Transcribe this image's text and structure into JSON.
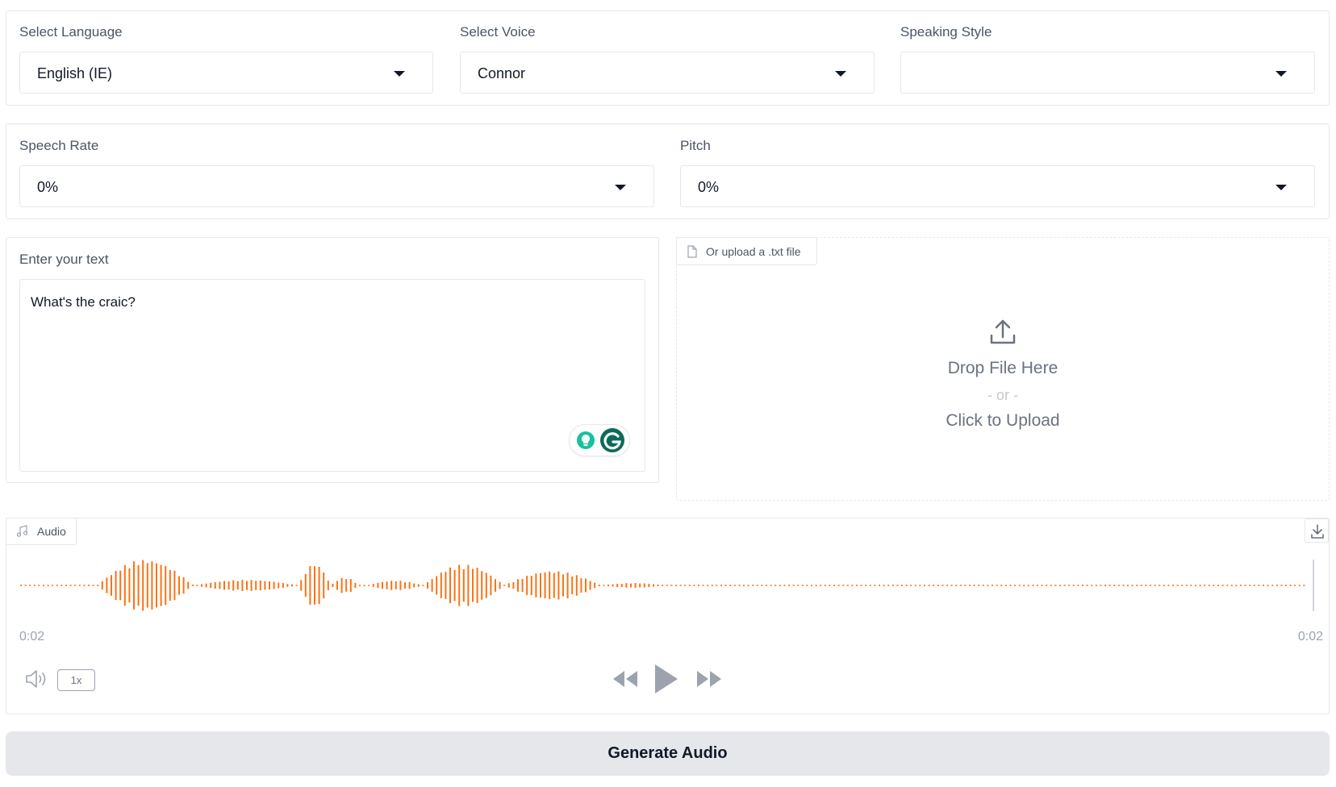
{
  "language": {
    "label": "Select Language",
    "value": "English (IE)"
  },
  "voice": {
    "label": "Select Voice",
    "value": "Connor"
  },
  "style": {
    "label": "Speaking Style",
    "value": ""
  },
  "rate": {
    "label": "Speech Rate",
    "value": "0%"
  },
  "pitch": {
    "label": "Pitch",
    "value": "0%"
  },
  "text_input": {
    "label": "Enter your text",
    "value": "What's the craic?"
  },
  "upload": {
    "tab_label": "Or upload a .txt file",
    "drop_text": "Drop File Here",
    "or_text": "- or -",
    "click_text": "Click to Upload"
  },
  "audio": {
    "label": "Audio",
    "current_time": "0:02",
    "duration": "0:02",
    "speed": "1x"
  },
  "generate_button": "Generate Audio",
  "colors": {
    "waveform": "#f97316",
    "accent_green": "#15c39a",
    "grammarly_dark": "#0c6b58"
  },
  "icons": [
    "caret-down-icon",
    "file-icon",
    "upload-icon",
    "music-note-icon",
    "download-icon",
    "volume-icon",
    "rewind-icon",
    "play-icon",
    "fast-forward-icon",
    "grammarly-icon"
  ]
}
